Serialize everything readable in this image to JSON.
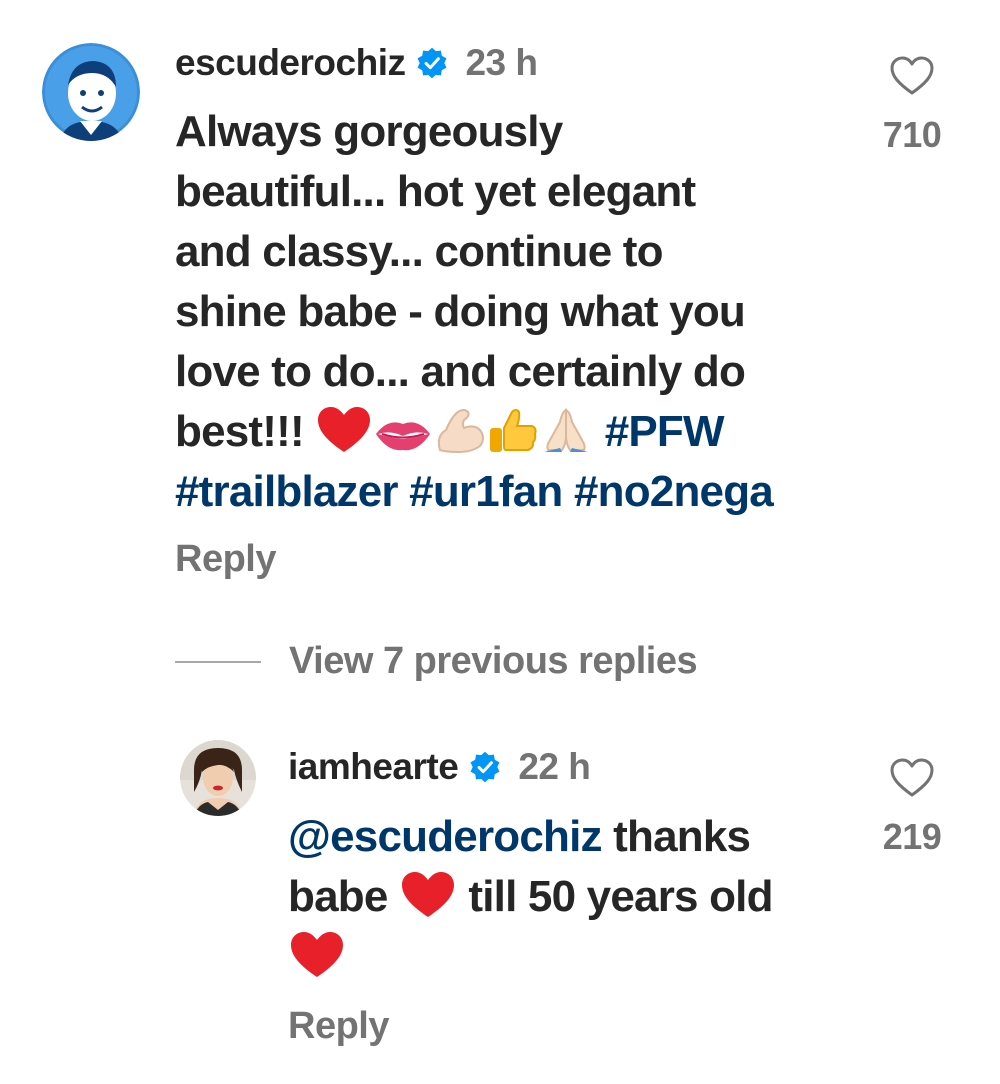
{
  "comment": {
    "username": "escuderochiz",
    "verified_icon": "verified-badge-icon",
    "time": "23 h",
    "text_lines": [
      "Always gorgeously",
      "beautiful... hot yet elegant",
      "and classy... continue to",
      "shine babe - doing what you",
      "love to do... and certainly do"
    ],
    "last_line_text": "best!!!",
    "emojis": [
      "red-heart-emoji",
      "lips-emoji",
      "flexed-biceps-emoji",
      "thumbs-up-emoji",
      "folded-hands-emoji"
    ],
    "hashtags_line1": "#PFW",
    "hashtags_line2": [
      "#trailblazer",
      "#ur1fan",
      "#no2nega"
    ],
    "reply_label": "Reply",
    "like_count": "710",
    "like_icon": "heart-outline-icon"
  },
  "view_replies_label": "View 7 previous replies",
  "reply": {
    "username": "iamhearte",
    "verified_icon": "verified-badge-icon",
    "time": "22 h",
    "mention": "@escuderochiz",
    "text_line1_rest": " thanks",
    "text_line2_start": "babe",
    "text_line2_end": " till 50 years old",
    "emojis": [
      "red-heart-emoji",
      "red-heart-emoji"
    ],
    "reply_label": "Reply",
    "like_count": "219",
    "like_icon": "heart-outline-icon"
  },
  "colors": {
    "text": "#262626",
    "secondary": "#737373",
    "link": "#00376b",
    "verified": "#0095f6",
    "heart": "#e8202a"
  }
}
